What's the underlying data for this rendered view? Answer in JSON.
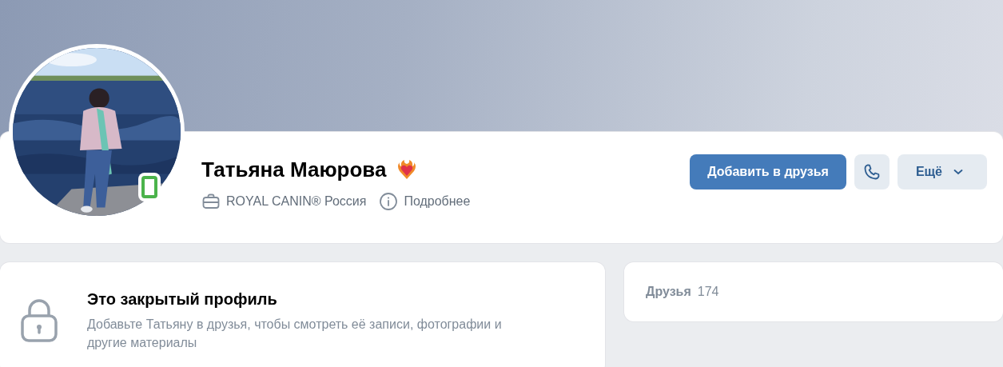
{
  "profile": {
    "name": "Татьяна Маюрова",
    "online": true,
    "has_badge": true,
    "info": [
      {
        "kind": "work",
        "text": "ROYAL CANIN® Россия"
      },
      {
        "kind": "details",
        "text": "Подробнее"
      }
    ],
    "buttons": [
      {
        "kind": "primary",
        "label": "Добавить в друзья"
      },
      {
        "kind": "call"
      },
      {
        "kind": "more",
        "label": "Ещё"
      }
    ]
  },
  "private_notice": {
    "title": "Это закрытый профиль",
    "text": "Добавьте Татьяну в друзья, чтобы смотреть её записи, фотографии и другие материалы"
  },
  "friends": {
    "label": "Друзья",
    "count": "174"
  }
}
